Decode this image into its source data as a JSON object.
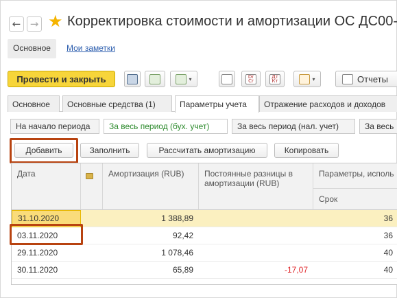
{
  "window": {
    "title": "Корректировка стоимости и амортизации ОС ДС00-"
  },
  "subtabs": {
    "main_label": "Основное",
    "notes_label": "Мои заметки"
  },
  "toolbar": {
    "post_close_label": "Провести и закрыть",
    "dt_kt_icon_text": "Дт Кт",
    "reports_label": "Отчеты"
  },
  "tabs": [
    {
      "label": "Основное"
    },
    {
      "label": "Основные средства (1)"
    },
    {
      "label": "Параметры учета"
    },
    {
      "label": "Отражение расходов и доходов"
    }
  ],
  "period_tabs": [
    {
      "label": "На начало периода"
    },
    {
      "label": "За весь период (бух. учет)"
    },
    {
      "label": "За весь период (нал. учет)"
    },
    {
      "label": "За весь"
    }
  ],
  "actions": {
    "add_label": "Добавить",
    "fill_label": "Заполнить",
    "calc_label": "Рассчитать амортизацию",
    "copy_label": "Копировать"
  },
  "table": {
    "columns": {
      "date": "Дата",
      "amortization": "Амортизация (RUB)",
      "permanent": "Постоянные разницы в амортизации (RUB)",
      "params": "Параметры, исполь",
      "term": "Срок"
    },
    "rows": [
      {
        "date": "31.10.2020",
        "amortization": "1 388,89",
        "permanent": "",
        "term": "36"
      },
      {
        "date": "03.11.2020",
        "amortization": "92,42",
        "permanent": "",
        "term": "36"
      },
      {
        "date": "29.11.2020",
        "amortization": "1 078,46",
        "permanent": "",
        "term": "40"
      },
      {
        "date": "30.11.2020",
        "amortization": "65,89",
        "permanent": "-17,07",
        "term": "40"
      }
    ]
  },
  "colors": {
    "accent": "#f7d53a",
    "highlight": "#b84310",
    "selected_row": "#fbf0c0",
    "negative": "#e0262a",
    "active_period_tab": "#2c8a2c"
  }
}
